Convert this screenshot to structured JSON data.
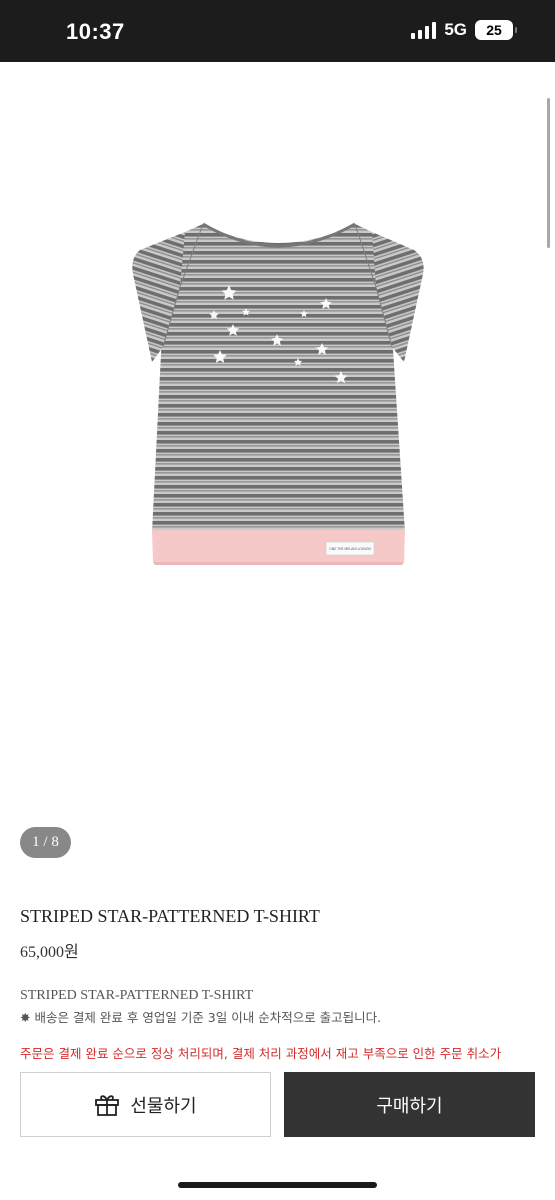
{
  "status": {
    "time": "10:37",
    "network": "5G",
    "battery": "25"
  },
  "gallery": {
    "counter": "1 / 8",
    "label_text": "ONE THE MELANI LOUVEN"
  },
  "product": {
    "title": "STRIPED STAR-PATTERNED T-SHIRT",
    "price": "65,000원",
    "desc_title": "STRIPED STAR-PATTERNED T-SHIRT",
    "desc_note": "✸ 배송은 결제 완료 후 영업일 기준 3일 이내 순차적으로 출고됩니다.",
    "desc_warning": "주문은 결제 완료 순으로 정상 처리되며, 결제 처리 과정에서 재고 부족으로 인한 주문 취소가"
  },
  "actions": {
    "gift_label": "선물하기",
    "buy_label": "구매하기"
  },
  "colors": {
    "buy_button": "#333333",
    "warning_text": "#d52b2b",
    "hem_pink": "#f5c9c8"
  }
}
